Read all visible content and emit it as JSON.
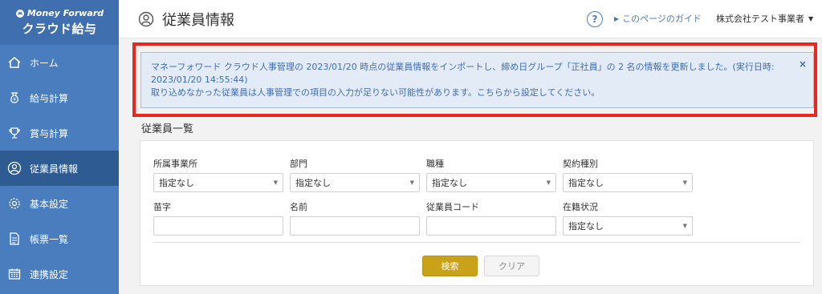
{
  "brand": {
    "top": "Money Forward",
    "bottom": "クラウド給与"
  },
  "sidebar": {
    "items": [
      {
        "label": "ホーム",
        "icon": "home-icon"
      },
      {
        "label": "給与計算",
        "icon": "money-bag-icon"
      },
      {
        "label": "賞与計算",
        "icon": "trophy-icon"
      },
      {
        "label": "従業員情報",
        "icon": "employee-icon",
        "active": true
      },
      {
        "label": "基本設定",
        "icon": "gear-icon"
      },
      {
        "label": "帳票一覧",
        "icon": "document-icon"
      },
      {
        "label": "連携設定",
        "icon": "calendar-icon"
      }
    ]
  },
  "header": {
    "title": "従業員情報",
    "help": "?",
    "guide_label": "このページのガイド",
    "company": "株式会社テスト事業者"
  },
  "notice": {
    "line1": "マネーフォワード クラウド人事管理の 2023/01/20 時点の従業員情報をインポートし、締め日グループ「正社員」の 2 名の情報を更新しました。(実行日時:",
    "line2": "2023/01/20 14:55:44)",
    "line3": "取り込めなかった従業員は人事管理での項目の入力が足りない可能性があります。こちらから設定してください。",
    "close": "×"
  },
  "section_title": "従業員一覧",
  "filters": {
    "office": {
      "label": "所属事業所",
      "value": "指定なし"
    },
    "department": {
      "label": "部門",
      "value": "指定なし"
    },
    "job": {
      "label": "職種",
      "value": "指定なし"
    },
    "contract": {
      "label": "契約種別",
      "value": "指定なし"
    },
    "last_name": {
      "label": "苗字",
      "value": ""
    },
    "first_name": {
      "label": "名前",
      "value": ""
    },
    "employee_code": {
      "label": "従業員コード",
      "value": ""
    },
    "status": {
      "label": "在籍状況",
      "value": "指定なし"
    }
  },
  "buttons": {
    "search": "検索",
    "clear": "クリア"
  },
  "colors": {
    "sidebar": "#4a7dbd",
    "sidebar_active": "#2f5b93",
    "notice_bg": "#e3ebf6",
    "notice_text": "#3f6db5",
    "highlight_border": "#e8281e",
    "search_button": "#c9a219"
  }
}
